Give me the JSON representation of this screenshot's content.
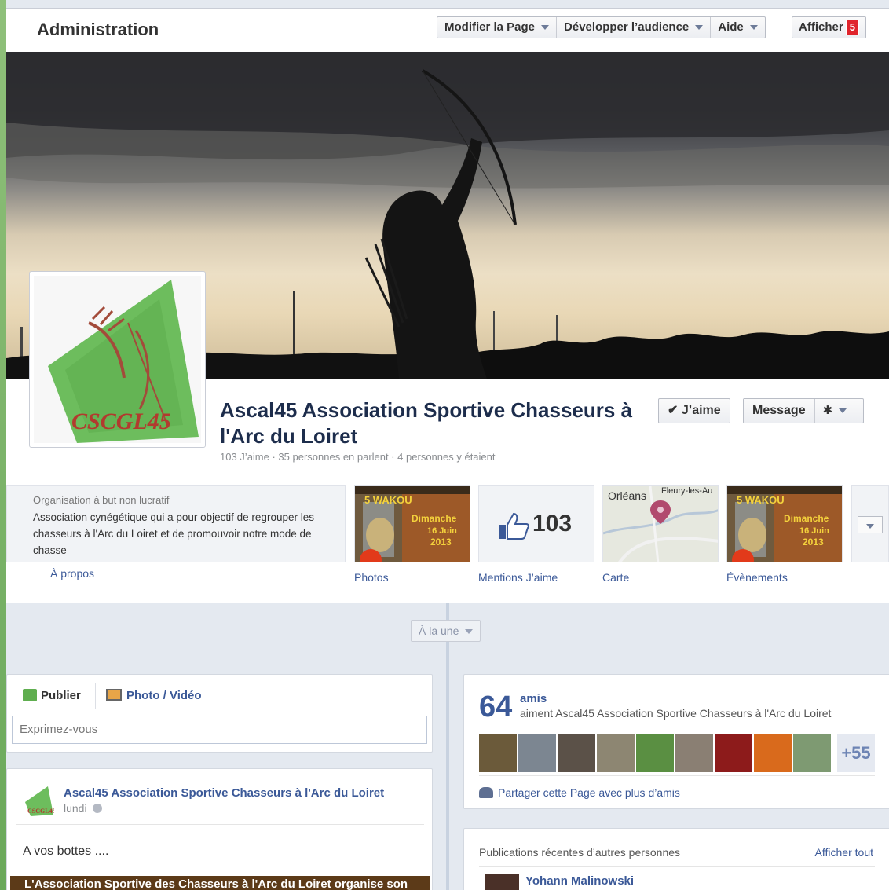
{
  "admin": {
    "title": "Administration",
    "menu": [
      {
        "label": "Modifier la Page"
      },
      {
        "label": "Développer l’audience"
      },
      {
        "label": "Aide"
      }
    ],
    "show_label": "Afficher",
    "show_badge": "5"
  },
  "page": {
    "name": "Ascal45 Association Sportive Chasseurs à l'Arc du Loiret",
    "stats": "103 J’aime · 35 personnes en parlent · 4 personnes y étaient",
    "like_label": "✔ J’aime",
    "message_label": "Message"
  },
  "about": {
    "category": "Organisation à but non lucratif",
    "description": "Association cynégétique qui a pour objectif de regrouper les chasseurs à l'Arc du Loiret et de promouvoir notre mode de chasse",
    "link": "À propos"
  },
  "tiles": {
    "photos": "Photos",
    "likes_label": "Mentions J’aime",
    "likes_count": "103",
    "map": "Carte",
    "map_city": "Orléans",
    "map_town": "Fleury-les-Au",
    "events": "Évènements"
  },
  "timeline": {
    "filter": "À la une"
  },
  "composer": {
    "publish": "Publier",
    "photo_video": "Photo / Vidéo",
    "placeholder": "Exprimez-vous"
  },
  "post": {
    "author": "Ascal45 Association Sportive Chasseurs à l'Arc du Loiret",
    "date": "lundi",
    "text": "A vos bottes ....",
    "banner": "L'Association Sportive des Chasseurs à l'Arc du Loiret organise son"
  },
  "friends": {
    "count": "64",
    "unit": "amis",
    "subtitle": "aiment Ascal45 Association Sportive Chasseurs à l'Arc du Loiret",
    "more": "+55",
    "share": "Partager cette Page avec plus d’amis",
    "thumb_colors": [
      "#6b5a3a",
      "#7c8691",
      "#5b5148",
      "#8d8672",
      "#5a8f42",
      "#8a7f73",
      "#8d1b1b",
      "#d96a1c",
      "#7e9a72"
    ]
  },
  "recent": {
    "title": "Publications récentes d’autres personnes",
    "see_all": "Afficher tout",
    "first_author": "Yohann Malinowski"
  }
}
